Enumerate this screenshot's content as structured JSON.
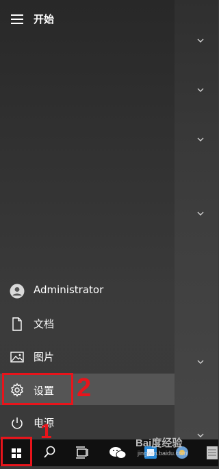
{
  "start_menu": {
    "title": "开始",
    "items": [
      {
        "label": "Administrator",
        "icon": "user-avatar-icon"
      },
      {
        "label": "文档",
        "icon": "document-icon"
      },
      {
        "label": "图片",
        "icon": "picture-icon"
      },
      {
        "label": "设置",
        "icon": "gear-icon"
      },
      {
        "label": "电源",
        "icon": "power-icon"
      }
    ]
  },
  "annotations": {
    "step1": "1",
    "step2": "2",
    "color": "#e8141b"
  },
  "taskbar": {
    "buttons": [
      "windows-start-icon",
      "search-icon",
      "task-view-icon",
      "wechat-icon",
      "app-icon",
      "app-icon-2",
      "app-icon-3"
    ]
  },
  "watermark": {
    "brand": "Bai度经验",
    "url": "jingyan.baidu.com"
  }
}
